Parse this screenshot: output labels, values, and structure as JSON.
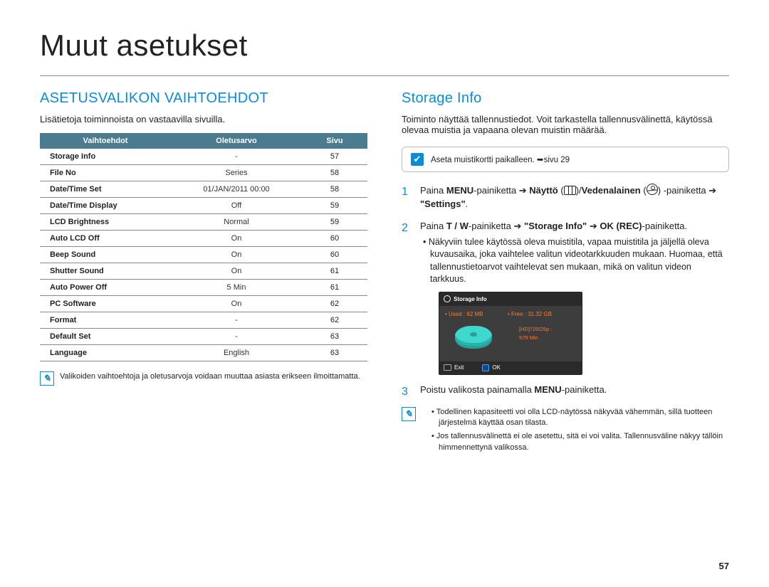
{
  "page_title": "Muut asetukset",
  "page_number": "57",
  "left": {
    "heading": "ASETUSVALIKON VAIHTOEHDOT",
    "lead": "Lisätietoja toiminnoista on vastaavilla sivuilla.",
    "table_headers": {
      "option": "Vaihtoehdot",
      "default": "Oletusarvo",
      "page": "Sivu"
    },
    "rows": [
      {
        "option": "Storage Info",
        "default": "-",
        "page": "57"
      },
      {
        "option": "File No",
        "default": "Series",
        "page": "58"
      },
      {
        "option": "Date/Time Set",
        "default": "01/JAN/2011 00:00",
        "page": "58"
      },
      {
        "option": "Date/Time Display",
        "default": "Off",
        "page": "59"
      },
      {
        "option": "LCD Brightness",
        "default": "Normal",
        "page": "59"
      },
      {
        "option": "Auto LCD Off",
        "default": "On",
        "page": "60"
      },
      {
        "option": "Beep Sound",
        "default": "On",
        "page": "60"
      },
      {
        "option": "Shutter Sound",
        "default": "On",
        "page": "61"
      },
      {
        "option": "Auto Power Off",
        "default": "5 Min",
        "page": "61"
      },
      {
        "option": "PC Software",
        "default": "On",
        "page": "62"
      },
      {
        "option": "Format",
        "default": "-",
        "page": "62"
      },
      {
        "option": "Default Set",
        "default": "-",
        "page": "63"
      },
      {
        "option": "Language",
        "default": "English",
        "page": "63"
      }
    ],
    "footnote": "Valikoiden vaihtoehtoja ja oletusarvoja voidaan muuttaa asiasta erikseen ilmoittamatta."
  },
  "right": {
    "heading": "Storage Info",
    "lead": "Toiminto näyttää tallennustiedot. Voit tarkastella tallennusvälinettä, käytössä olevaa muistia ja vapaana olevan muistin määrää.",
    "insert_card": "Aseta muistikortti paikalleen. ➥sivu 29",
    "step1_pieces": {
      "p1": "Paina ",
      "menu": "MENU",
      "p2": "-painiketta ➔ ",
      "naytto": "Näyttö",
      "slash": "/",
      "vedenalainen": "Vedenalainen",
      "p3": " -painiketta ➔ ",
      "settings": "\"Settings\"",
      "dot": "."
    },
    "step2_pieces": {
      "p1": "Paina ",
      "tw": "T / W",
      "p2": "-painiketta ➔ ",
      "si": "\"Storage Info\"",
      "arrow": " ➔ ",
      "ok": "OK (REC)",
      "p3": "-painiketta."
    },
    "step2_bullet": "Näkyviin tulee käytössä oleva muistitila, vapaa muistitila ja jäljellä oleva kuvausaika, joka vaihtelee valitun videotarkkuuden mukaan. Huomaa, että tallennustietoarvot vaihtelevat sen mukaan, mikä on valitun videon tarkkuus.",
    "screenshot": {
      "title": "Storage Info",
      "used": "• Used : 62 MB",
      "free": "• Free : 31.32 GB",
      "res": "[HD]720/25p :",
      "min": "579 Min",
      "exit": "Exit",
      "ok": "OK"
    },
    "step3_pieces": {
      "p1": "Poistu valikosta painamalla ",
      "menu": "MENU",
      "p2": "-painiketta."
    },
    "notes": [
      "Todellinen kapasiteetti voi olla LCD-näytössä näkyvää vähemmän, sillä tuotteen järjestelmä käyttää osan tilasta.",
      "Jos tallennusvälinettä ei ole asetettu, sitä ei voi valita. Tallennusväline näkyy tällöin himmennettynä valikossa."
    ]
  }
}
